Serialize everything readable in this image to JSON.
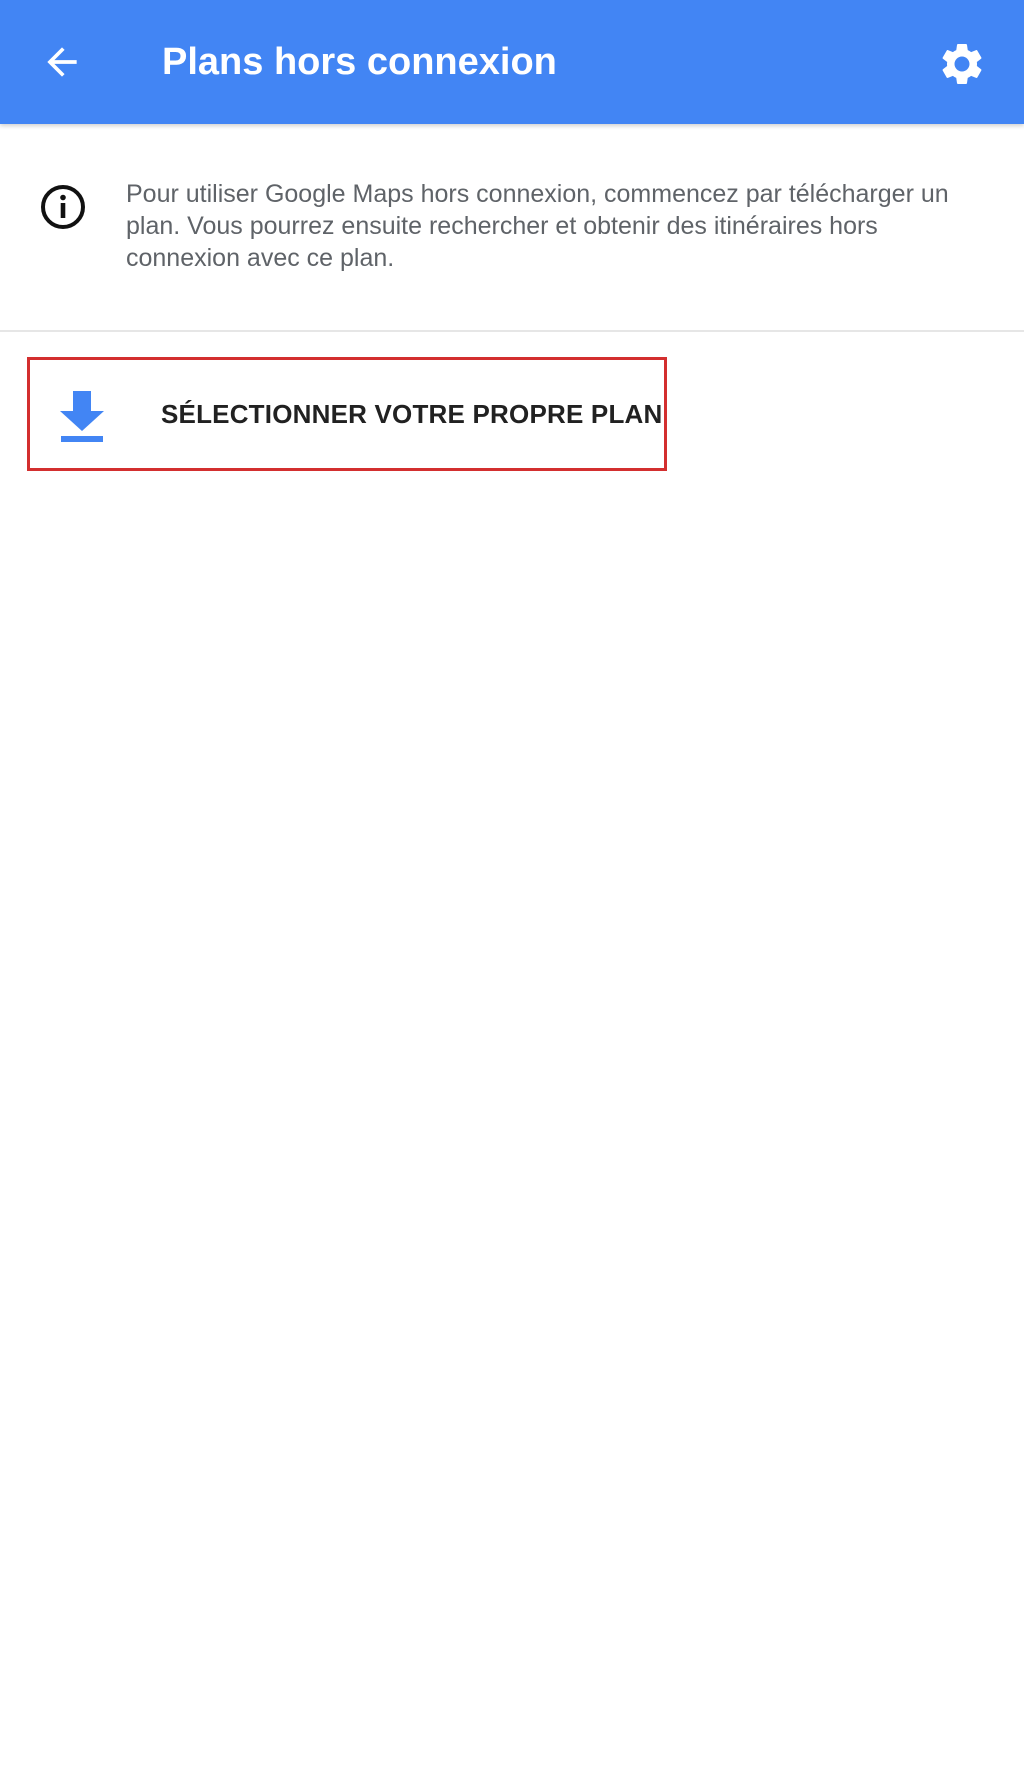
{
  "app_bar": {
    "title": "Plans hors connexion",
    "back_icon": "arrow-back-icon",
    "settings_icon": "gear-icon",
    "background_color": "#4285f4"
  },
  "info": {
    "icon": "info-icon",
    "text": "Pour utiliser Google Maps hors connexion, commencez par télécharger un plan. Vous pourrez ensuite rechercher et obtenir des itinéraires hors connexion avec ce plan."
  },
  "actions": {
    "select_map_label": "SÉLECTIONNER VOTRE PROPRE PLAN",
    "download_icon": "download-icon",
    "icon_color": "#4285f4",
    "highlight_color": "#d32f2f"
  }
}
